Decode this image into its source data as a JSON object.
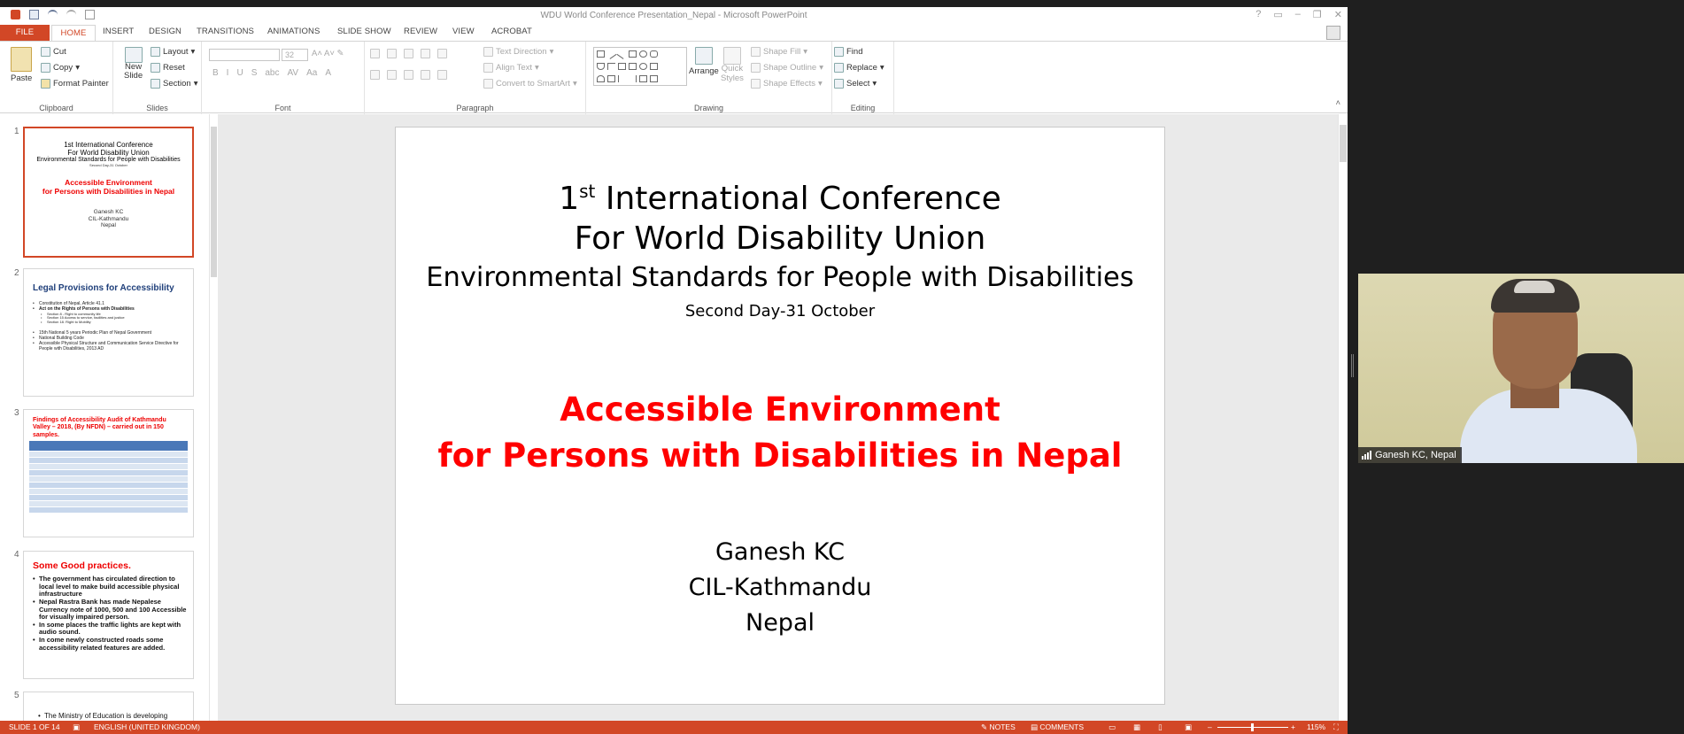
{
  "window": {
    "title": "WDU World Conference Presentation_Nepal - Microsoft PowerPoint"
  },
  "tabs": [
    "FILE",
    "HOME",
    "INSERT",
    "DESIGN",
    "TRANSITIONS",
    "ANIMATIONS",
    "SLIDE SHOW",
    "REVIEW",
    "VIEW",
    "ACROBAT"
  ],
  "ribbon": {
    "clipboard": {
      "label": "Clipboard",
      "paste": "Paste",
      "cut": "Cut",
      "copy": "Copy",
      "format_painter": "Format Painter"
    },
    "slides": {
      "label": "Slides",
      "new_slide_1": "New",
      "new_slide_2": "Slide",
      "layout": "Layout",
      "reset": "Reset",
      "section": "Section"
    },
    "font": {
      "label": "Font",
      "size": "32"
    },
    "paragraph": {
      "label": "Paragraph",
      "text_direction": "Text Direction",
      "align_text": "Align Text",
      "convert_smartart": "Convert to SmartArt"
    },
    "drawing": {
      "label": "Drawing",
      "arrange": "Arrange",
      "quick_styles_1": "Quick",
      "quick_styles_2": "Styles",
      "shape_fill": "Shape Fill",
      "shape_outline": "Shape Outline",
      "shape_effects": "Shape Effects"
    },
    "editing": {
      "label": "Editing",
      "find": "Find",
      "replace": "Replace",
      "select": "Select"
    }
  },
  "thumbnails": [
    {
      "number": "1",
      "line1": "1st International Conference",
      "line2": "For World Disability Union",
      "line3": "Environmental Standards for People with Disabilities",
      "line4": "Second Day-31 October",
      "red1": "Accessible Environment",
      "red2": "for Persons with Disabilities in Nepal",
      "n1": "Ganesh KC",
      "n2": "CIL-Kathmandu",
      "n3": "Nepal"
    },
    {
      "number": "2",
      "title": "Legal Provisions for Accessibility",
      "b1": "Constitution of Nepal, Article 41.1",
      "b2": "Act on the Rights of Persons with Disabilities",
      "b2a": "Section 8 - Right to community life",
      "b2b": "Section 15 Access to service, facilities and justice",
      "b2c": "Section 18. Right to Mobility",
      "b3": "15th National 5 years Periodic Plan of Nepal Government",
      "b4": "National Building Code",
      "b5": "Accessible Physical Structure and Communication Service Directive for People with Disabilities, 2013 AD"
    },
    {
      "number": "3",
      "title": "Findings of Accessibility Audit of Kathmandu Valley – 2018, (By NFDN) – carried out in 150 samples."
    },
    {
      "number": "4",
      "title": "Some Good practices.",
      "b1": "The government has circulated direction to local level to make build accessible physical infrastructure",
      "b2": "Nepal Rastra Bank has made Nepalese Currency note of 1000, 500 and 100 Accessible for visually impaired person.",
      "b3": "In some places the traffic lights are kept with audio sound.",
      "b4": "In come newly constructed roads some accessibility related features are added."
    },
    {
      "number": "5",
      "b1": "The Ministry of Education is developing"
    }
  ],
  "slide": {
    "line1": "1",
    "line1_sup": "st",
    "line1_rest": " International Conference",
    "line2": "For World Disability Union",
    "line3": "Environmental Standards for People with Disabilities",
    "line4": "Second Day-31 October",
    "red1": "Accessible Environment",
    "red2": "for Persons with Disabilities in Nepal",
    "name": "Ganesh KC",
    "org": "CIL-Kathmandu",
    "country": "Nepal"
  },
  "statusbar": {
    "slide": "SLIDE 1 OF 14",
    "language": "ENGLISH (UNITED KINGDOM)",
    "notes": "NOTES",
    "comments": "COMMENTS",
    "zoom": "115%"
  },
  "video": {
    "participant": "Ganesh KC, Nepal"
  },
  "colors": {
    "accent": "#d24726",
    "slide_red": "#ff0000"
  }
}
